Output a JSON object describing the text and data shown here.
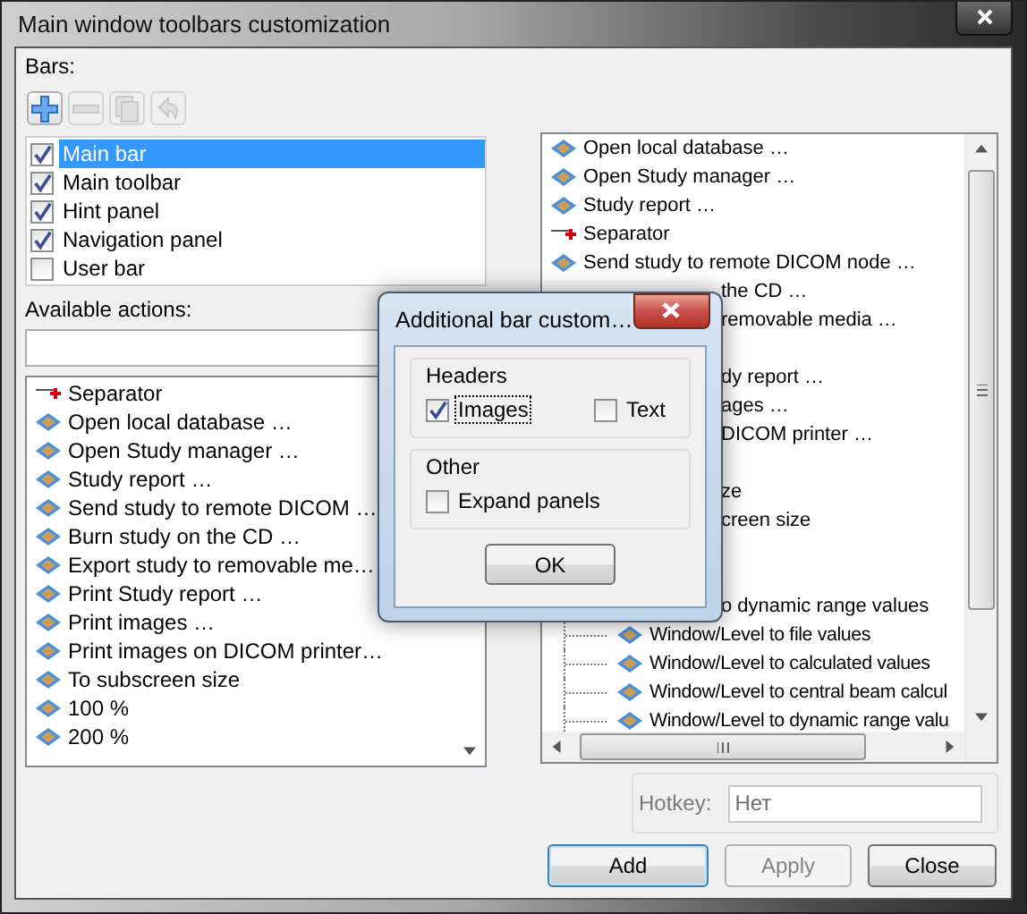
{
  "window": {
    "title": "Main window toolbars customization"
  },
  "bars": {
    "label": "Bars:",
    "toolbar": [
      {
        "kind": "add",
        "disabled": false
      },
      {
        "kind": "remove",
        "disabled": true
      },
      {
        "kind": "copy",
        "disabled": true
      },
      {
        "kind": "undo",
        "disabled": true
      }
    ],
    "items": [
      {
        "label": "Main bar",
        "checked": true,
        "selected": true
      },
      {
        "label": "Main toolbar",
        "checked": true,
        "selected": false
      },
      {
        "label": "Hint panel",
        "checked": true,
        "selected": false
      },
      {
        "label": "Navigation panel",
        "checked": true,
        "selected": false
      },
      {
        "label": "User bar",
        "checked": false,
        "selected": false
      }
    ]
  },
  "available_actions": {
    "label": "Available actions:",
    "items": [
      {
        "kind": "separator",
        "label": "Separator"
      },
      {
        "kind": "action",
        "label": "Open local database …"
      },
      {
        "kind": "action",
        "label": "Open Study manager …"
      },
      {
        "kind": "action",
        "label": "Study report …"
      },
      {
        "kind": "action",
        "label": "Send study to remote DICOM …"
      },
      {
        "kind": "action",
        "label": "Burn study on the CD …"
      },
      {
        "kind": "action",
        "label": "Export study to removable me…"
      },
      {
        "kind": "action",
        "label": "Print Study report …"
      },
      {
        "kind": "action",
        "label": "Print images …"
      },
      {
        "kind": "action",
        "label": "Print images on DICOM printer…"
      },
      {
        "kind": "action",
        "label": "To subscreen size"
      },
      {
        "kind": "action",
        "label": "100 %"
      },
      {
        "kind": "action",
        "label": "200 %"
      }
    ]
  },
  "bar_actions": {
    "items": [
      {
        "kind": "action",
        "label": "Open local database …"
      },
      {
        "kind": "action",
        "label": "Open Study manager …"
      },
      {
        "kind": "action",
        "label": "Study report …"
      },
      {
        "kind": "separator",
        "label": "Separator"
      },
      {
        "kind": "action",
        "label": "Send study to remote DICOM node …"
      },
      {
        "kind": "covered",
        "label": "the CD …"
      },
      {
        "kind": "covered",
        "label": "removable media …"
      },
      {
        "kind": "hidden"
      },
      {
        "kind": "covered",
        "label": "dy report …"
      },
      {
        "kind": "covered",
        "label": "ages …"
      },
      {
        "kind": "covered",
        "label": "DICOM printer …"
      },
      {
        "kind": "hidden"
      },
      {
        "kind": "covered",
        "label": "ze"
      },
      {
        "kind": "covered",
        "label": "creen size"
      },
      {
        "kind": "hidden"
      },
      {
        "kind": "hidden"
      },
      {
        "kind": "covered",
        "label": "o dynamic range values"
      },
      {
        "kind": "child",
        "label": "Window/Level to file values"
      },
      {
        "kind": "child",
        "label": "Window/Level to calculated values"
      },
      {
        "kind": "child",
        "label": "Window/Level to central beam calcul"
      },
      {
        "kind": "child",
        "label": "Window/Level to dynamic range valu"
      }
    ]
  },
  "hotkey": {
    "label": "Hotkey:",
    "value": "Нет",
    "disabled": true
  },
  "buttons": [
    {
      "label": "Add",
      "default": true,
      "disabled": false
    },
    {
      "label": "Apply",
      "default": false,
      "disabled": true
    },
    {
      "label": "Close",
      "default": false,
      "disabled": false
    }
  ],
  "dialog": {
    "title": "Additional bar custom…",
    "groups": [
      {
        "title": "Headers",
        "options": [
          {
            "label": "Images",
            "checked": true,
            "focused": true
          },
          {
            "label": "Text",
            "checked": false,
            "focused": false
          }
        ]
      },
      {
        "title": "Other",
        "options": [
          {
            "label": "Expand panels",
            "checked": false,
            "focused": false
          }
        ]
      }
    ],
    "ok": "OK"
  }
}
